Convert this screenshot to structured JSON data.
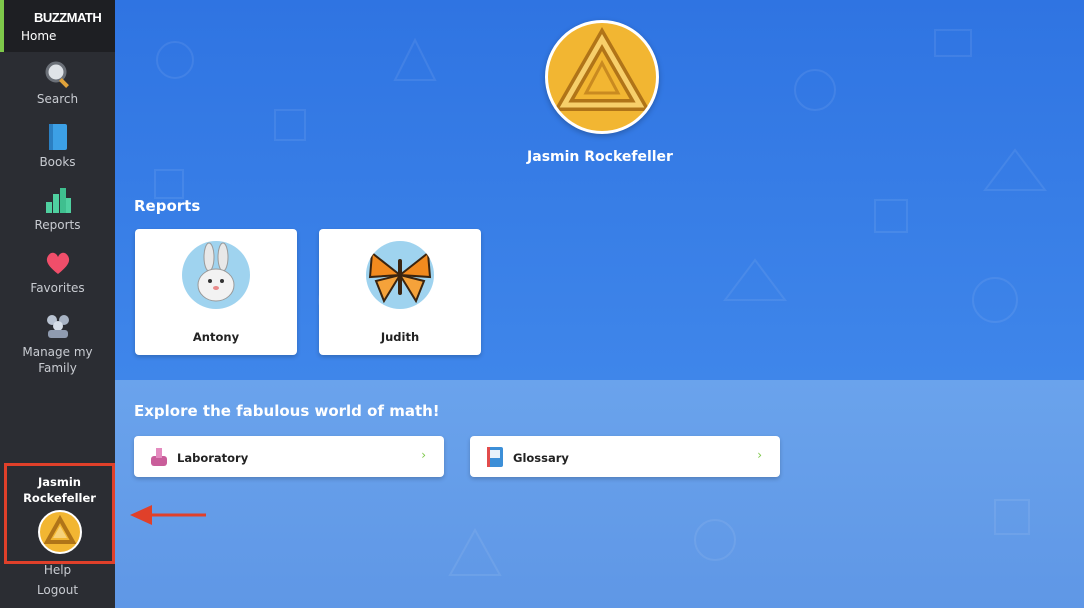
{
  "sidebar": {
    "logo": "BUZZMATH",
    "home": "Home",
    "items": [
      {
        "label": "Search",
        "icon": "magnifier-icon"
      },
      {
        "label": "Books",
        "icon": "book-icon"
      },
      {
        "label": "Reports",
        "icon": "bar-chart-icon"
      },
      {
        "label": "Favorites",
        "icon": "heart-icon"
      },
      {
        "label": "Manage my Family",
        "icon": "family-icon"
      }
    ],
    "profile": {
      "name": "Jasmin Rockefeller"
    },
    "help": "Help",
    "logout": "Logout"
  },
  "main": {
    "user_name": "Jasmin Rockefeller",
    "reports_title": "Reports",
    "reports": [
      {
        "name": "Antony",
        "avatar": "rabbit"
      },
      {
        "name": "Judith",
        "avatar": "butterfly"
      }
    ],
    "explore_title": "Explore the fabulous world of math!",
    "links": [
      {
        "label": "Laboratory",
        "icon": "lab-icon",
        "chevron": "›"
      },
      {
        "label": "Glossary",
        "icon": "glossary-book-icon",
        "chevron": "›"
      }
    ]
  },
  "colors": {
    "accent": "#7ec84a",
    "highlight": "#e0402a",
    "sidebar": "#2b2d33",
    "background": "#3d7fe0"
  }
}
